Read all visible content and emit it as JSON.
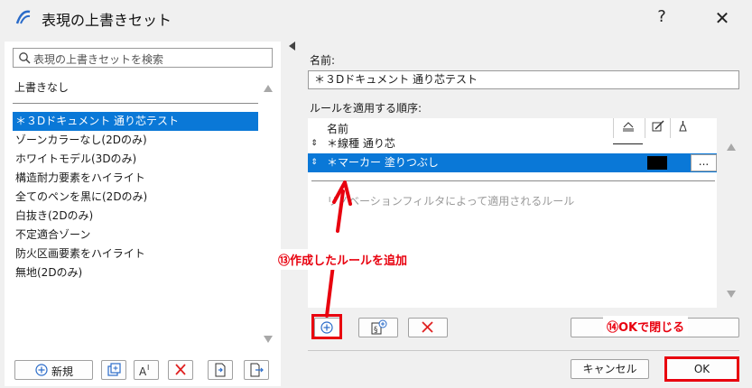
{
  "window": {
    "title": "表現の上書きセット",
    "help_label": "?",
    "close_label": "✕"
  },
  "left": {
    "search_placeholder": "表現の上書きセットを検索",
    "no_override": "上書きなし",
    "items": [
      {
        "label": "＊３Dドキュメント  通り芯テスト",
        "selected": true
      },
      {
        "label": "ゾーンカラーなし(2Dのみ)",
        "selected": false
      },
      {
        "label": "ホワイトモデル(3Dのみ)",
        "selected": false
      },
      {
        "label": "構造耐力要素をハイライト",
        "selected": false
      },
      {
        "label": "全てのペンを黒に(2Dのみ)",
        "selected": false
      },
      {
        "label": "白抜き(2Dのみ)",
        "selected": false
      },
      {
        "label": "不定適合ゾーン",
        "selected": false
      },
      {
        "label": "防火区画要素をハイライト",
        "selected": false
      },
      {
        "label": "無地(2Dのみ)",
        "selected": false
      }
    ],
    "new_label": "新規"
  },
  "right": {
    "name_label": "名前:",
    "name_value": "＊３Dドキュメント  通り芯テスト",
    "order_label": "ルールを適用する順序:",
    "col_name": "名前",
    "rules": [
      {
        "handle": "⇕",
        "name": "＊線種 通り芯",
        "selected": false
      },
      {
        "handle": "⇕",
        "name": "＊マーカー  塗りつぶし",
        "selected": true,
        "more": "..."
      }
    ],
    "renovation_text": "リノベーションフィルタによって適用されるルール",
    "cancel_label": "キャンセル",
    "ok_label": "OK"
  },
  "annotations": {
    "add_rule": "⑬作成したルールを追加",
    "close_ok": "⑭OKで閉じる"
  },
  "colors": {
    "selection": "#0a78d7",
    "annotation_red": "#e8000e"
  }
}
